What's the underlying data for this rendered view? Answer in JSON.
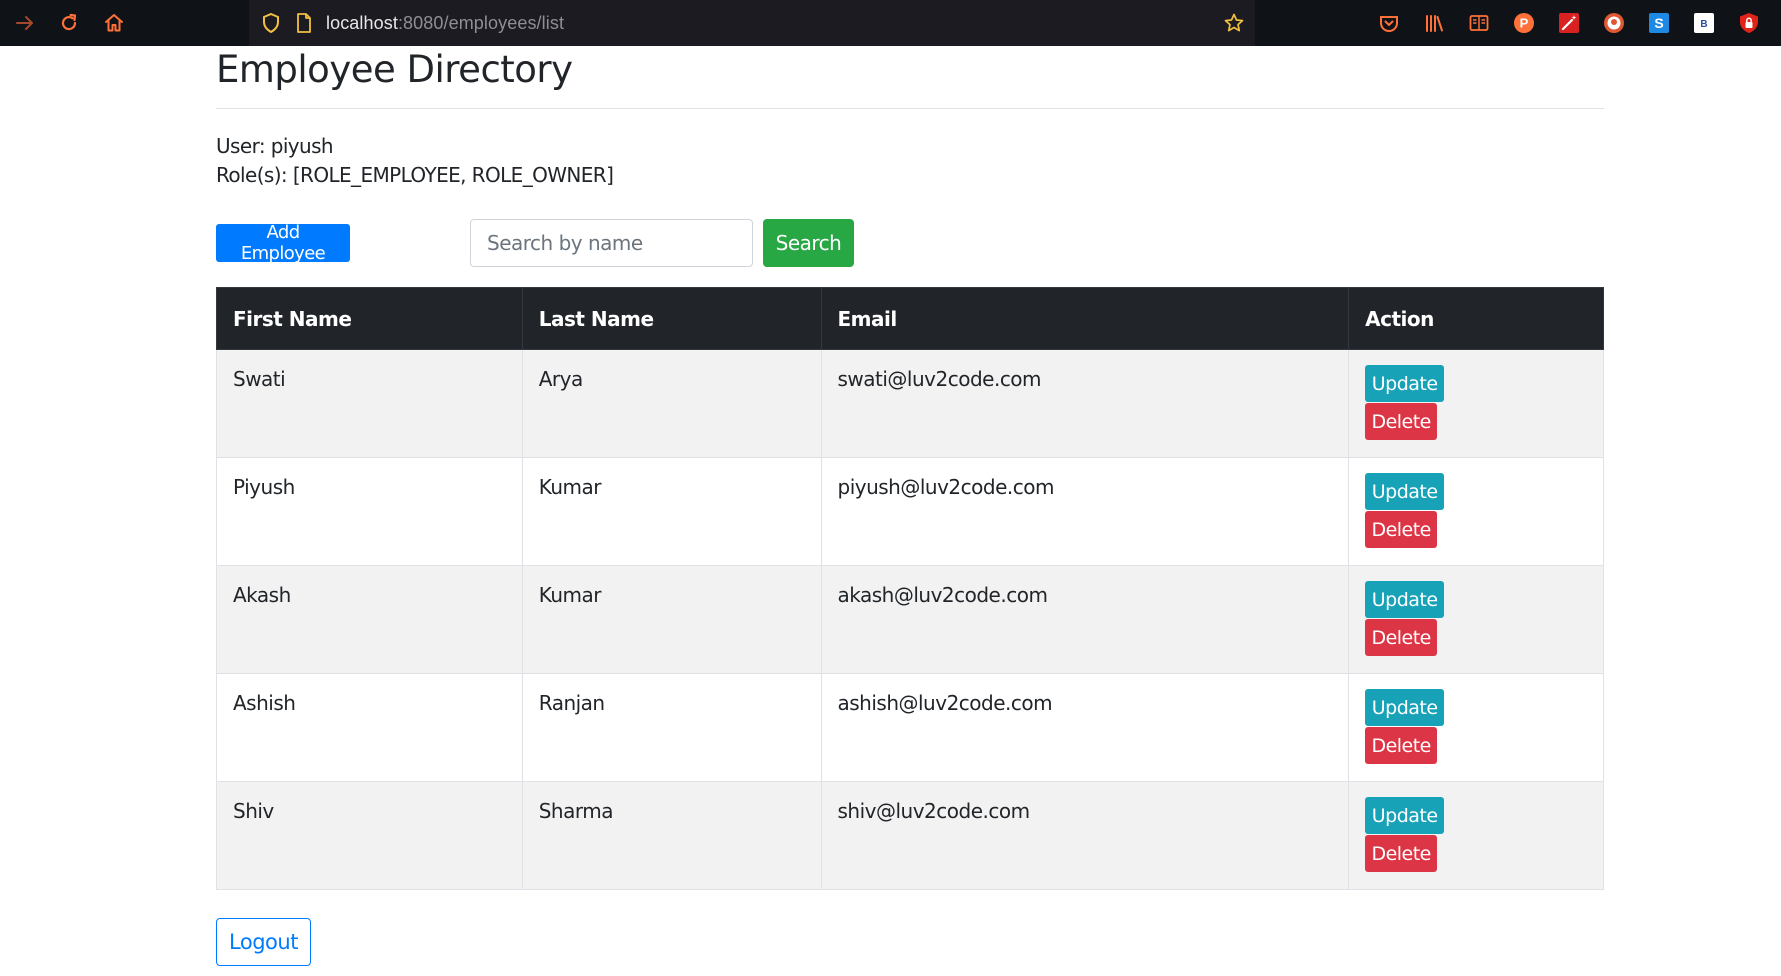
{
  "browser": {
    "url_host": "localhost",
    "url_path": ":8080/employees/list",
    "colors": {
      "toolbar": "#0f1216",
      "urlbar": "#1c1b22",
      "icon_orange": "#ff7139"
    },
    "icons": [
      "forward-icon",
      "reload-icon",
      "home-icon",
      "shield-icon",
      "page-icon",
      "bookmark-star-icon",
      "pocket-icon",
      "library-icon",
      "reader-view-icon",
      "extension-p-icon",
      "extension-wand-icon",
      "duckduckgo-icon",
      "extension-s-icon",
      "extension-b-icon",
      "extension-lock-icon"
    ]
  },
  "page": {
    "title": "Employee Directory",
    "user_line": "User: piyush",
    "roles_line": "Role(s): [ROLE_EMPLOYEE, ROLE_OWNER]",
    "add_button": "Add Employee",
    "search_placeholder": "Search by name",
    "search_value": "",
    "search_button": "Search",
    "logout_button": "Logout"
  },
  "table": {
    "headers": [
      "First Name",
      "Last Name",
      "Email",
      "Action"
    ],
    "update_label": "Update",
    "delete_label": "Delete",
    "rows": [
      {
        "first": "Swati",
        "last": "Arya",
        "email": "swati@luv2code.com"
      },
      {
        "first": "Piyush",
        "last": "Kumar",
        "email": "piyush@luv2code.com"
      },
      {
        "first": "Akash",
        "last": "Kumar",
        "email": "akash@luv2code.com"
      },
      {
        "first": "Ashish",
        "last": "Ranjan",
        "email": "ashish@luv2code.com"
      },
      {
        "first": "Shiv",
        "last": "Sharma",
        "email": "shiv@luv2code.com"
      }
    ]
  },
  "colors": {
    "primary": "#007bff",
    "success": "#28a745",
    "info": "#17a2b8",
    "danger": "#dc3545",
    "table_header": "#212529",
    "row_stripe": "#f2f2f2"
  }
}
